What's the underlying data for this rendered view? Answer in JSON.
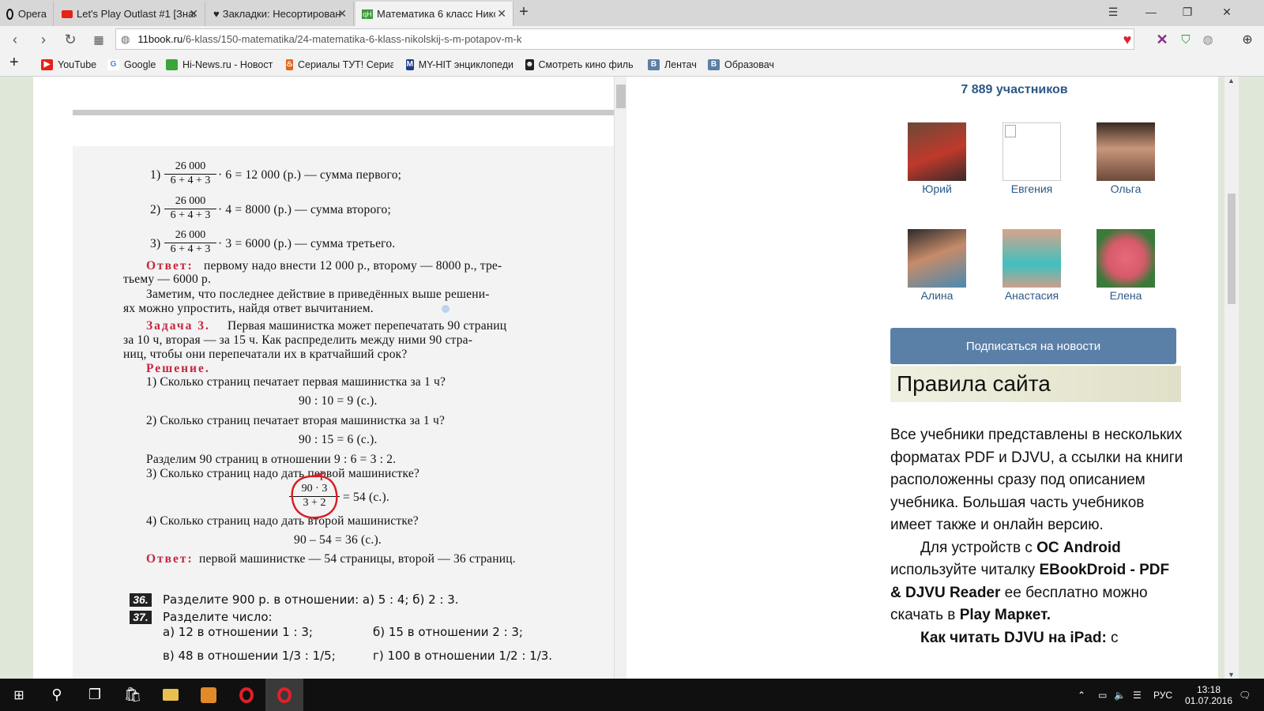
{
  "browser": {
    "app_name": "Opera",
    "tabs": [
      {
        "label": "Let's Play Outlast #1 [Знак"
      },
      {
        "label": "Закладки: Несортирован"
      },
      {
        "label": "Математика 6 класс Никс"
      }
    ],
    "new_tab_symbol": "+",
    "url_host": "11book.ru",
    "url_path": "/6-klass/150-matematika/24-matematika-6-klass-nikolskij-s-m-potapov-m-k"
  },
  "bookmarks": [
    {
      "label": "YouTube",
      "icon": "youtube-icon",
      "color": "#e62117"
    },
    {
      "label": "Google",
      "icon": "google-icon",
      "color": "#4285f4"
    },
    {
      "label": "Hi-News.ru - Новост",
      "icon": "cube-icon",
      "color": "#3aa53a"
    },
    {
      "label": "Сериалы ТУТ! Сериа",
      "icon": "flame-icon",
      "color": "#e0641a"
    },
    {
      "label": "MY-HIT энциклопеди",
      "icon": "myhit-icon",
      "color": "#1d3c8a"
    },
    {
      "label": "Смотреть кино филь",
      "icon": "film-icon",
      "color": "#222222"
    },
    {
      "label": "Лентач",
      "icon": "vk-icon",
      "color": "#5b7fa6"
    },
    {
      "label": "Образовач",
      "icon": "vk-icon",
      "color": "#5b7fa6"
    }
  ],
  "book": {
    "step1_num": "26 000",
    "step1_den": "6 + 4 + 3",
    "step1_rest": "· 6 = 12 000 (р.) — сумма первого;",
    "step1_idx": "1)",
    "step2_num": "26 000",
    "step2_den": "6 + 4 + 3",
    "step2_rest": "· 4 = 8000 (р.) — сумма второго;",
    "step2_idx": "2)",
    "step3_num": "26 000",
    "step3_den": "6 + 4 + 3",
    "step3_rest": "· 3 = 6000 (р.) — сумма третьего.",
    "step3_idx": "3)",
    "answer_label": "Ответ:",
    "answer1_text": "первому надо внести 12 000 р., второму — 8000 р., тре-",
    "answer1_text2": "тьему — 6000 р.",
    "note1": "Заметим, что последнее действие в приведённых выше решени-",
    "note2": "ях можно упростить, найдя ответ вычитанием.",
    "task_label": "Задача 3.",
    "task1": "Первая машинистка может перепечатать 90 страниц",
    "task2": "за 10 ч, вторая — за 15 ч. Как распределить между ними 90 стра-",
    "task3": "ниц, чтобы они перепечатали их в кратчайший срок?",
    "solution_label": "Решение.",
    "q1": "1) Сколько страниц печатает первая машинистка за 1 ч?",
    "q1_calc": "90 : 10 = 9 (с.).",
    "q2": "2) Сколько страниц печатает вторая машинистка за 1 ч?",
    "q2_calc": "90 : 15 = 6 (с.).",
    "ratio": "Разделим 90 страниц в отношении 9 : 6 = 3 : 2.",
    "q3": "3) Сколько страниц надо дать первой машинистке?",
    "q3_num": "90 · 3",
    "q3_den": "3 + 2",
    "q3_rest": "= 54 (с.).",
    "q4": "4) Сколько страниц надо дать второй машинистке?",
    "q4_calc": "90 – 54 = 36 (с.).",
    "answer2_text": "первой машинистке — 54 страницы, второй — 36 страниц.",
    "ex36_num": "36.",
    "ex36_text": "Разделите 900 р. в отношении: а) 5 : 4; б) 2 : 3.",
    "ex37_num": "37.",
    "ex37_text": "Разделите число:",
    "ex37_a": "а) 12 в отношении 1 : 3;",
    "ex37_b": "б) 15 в отношении 2 : 3;",
    "ex37_c": "в) 48 в отношении 1/3 : 1/5;",
    "ex37_d": "г) 100 в отношении 1/2 : 1/3."
  },
  "sidebar": {
    "members": "7 889 участников",
    "people": [
      {
        "name": "Юрий",
        "color": "#c0392b"
      },
      {
        "name": "Евгения",
        "color": "#ffffff"
      },
      {
        "name": "Ольга",
        "color": "#6b4a3a"
      },
      {
        "name": "Алина",
        "color": "#4a8ab0"
      },
      {
        "name": "Анастасия",
        "color": "#3fbfc0"
      },
      {
        "name": "Елена",
        "color": "#d55a6a"
      }
    ],
    "subscribe_label": "Подписаться на новости",
    "rules_title": "Правила сайта",
    "rules_p1": "Все учебники представлены в нескольких форматах PDF и DJVU, а ссылки на книги расположенны сразу под описанием учебника. Большая часть учебников имеет также и онлайн версию.",
    "rules_p2_a": "Для устройств с ",
    "rules_p2_b": "ОС Android",
    "rules_p2_c": " используйте читалку ",
    "rules_p2_d": "EBookDroid - PDF & DJVU Reader",
    "rules_p2_e": " ее бесплатно можно скачать в ",
    "rules_p2_f": "Play Маркет.",
    "rules_p3_a": "Как читать DJVU на iPad:",
    "rules_p3_b": " с"
  },
  "taskbar": {
    "language": "РУС",
    "time": "13:18",
    "date": "01.07.2016"
  }
}
